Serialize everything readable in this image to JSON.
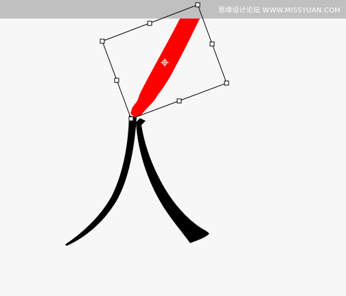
{
  "header": {
    "watermark_text": "思缘设计论坛 WWW.MISSYUAN.COM"
  },
  "canvas": {
    "background_color": "#f7f7f7",
    "ink_color": "#000000",
    "brush_color": "#ff0000"
  },
  "transform": {
    "handle_count": 8,
    "has_center_point": true
  }
}
